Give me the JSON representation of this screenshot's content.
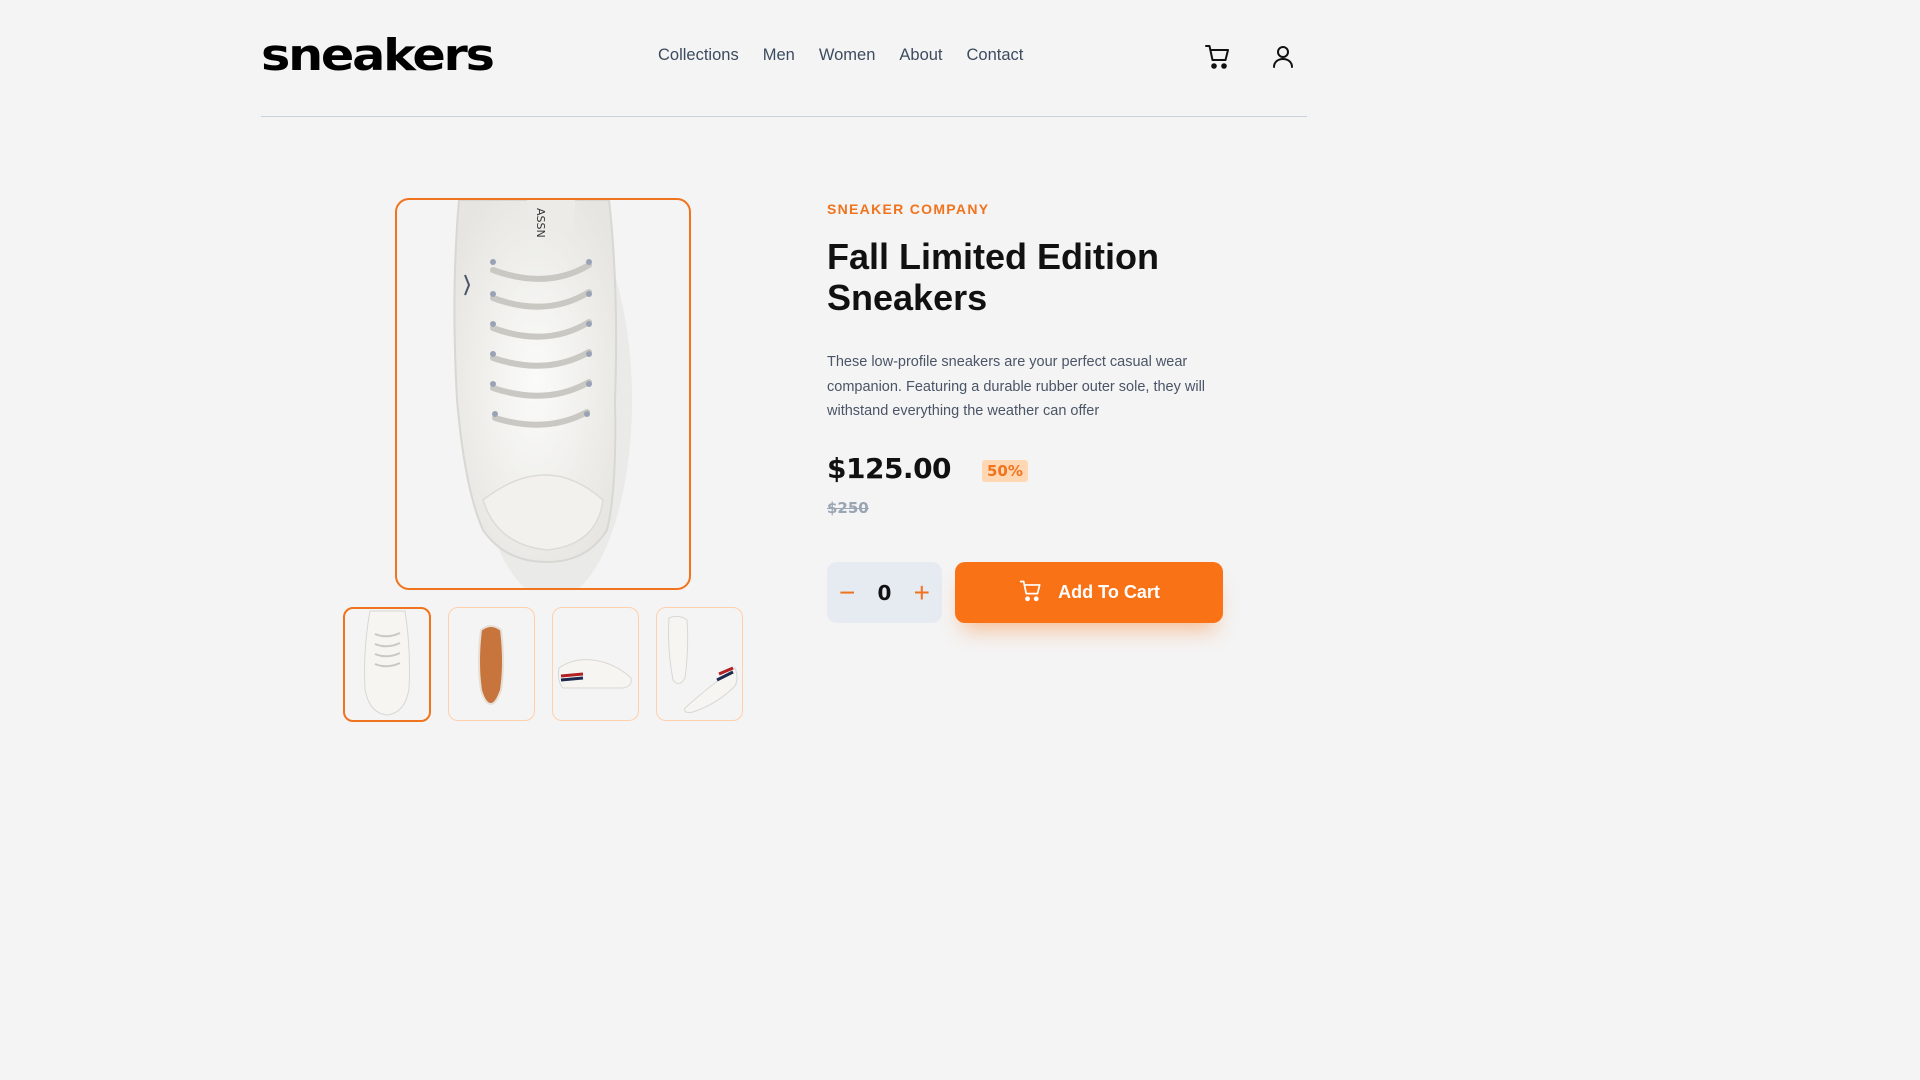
{
  "brand": {
    "logo_text": "sneakers"
  },
  "nav": {
    "items": [
      "Collections",
      "Men",
      "Women",
      "About",
      "Contact"
    ]
  },
  "header_icons": [
    "cart-icon",
    "user-icon"
  ],
  "product": {
    "company": "SNEAKER COMPANY",
    "title_line1": "Fall Limited Edition",
    "title_line2": "Sneakers",
    "description": "These low-profile sneakers are your perfect casual wear companion. Featuring a durable rubber outer sole, they will withstand everything the weather can offer",
    "price": "$125.00",
    "discount": "50%",
    "old_price": "$250"
  },
  "cart_controls": {
    "minus": "−",
    "quantity": "0",
    "plus": "+",
    "add_label": "Add To Cart"
  },
  "gallery": {
    "selected_index": 0,
    "thumbnails": [
      "sneaker-top-view",
      "sneaker-sole-view",
      "sneaker-side-view",
      "sneaker-pair-view"
    ]
  },
  "colors": {
    "accent": "#f97316",
    "accent_light": "#ffd7b3",
    "background": "#f4f4f4",
    "text_dark": "#111111",
    "text_muted": "#4a5567"
  }
}
